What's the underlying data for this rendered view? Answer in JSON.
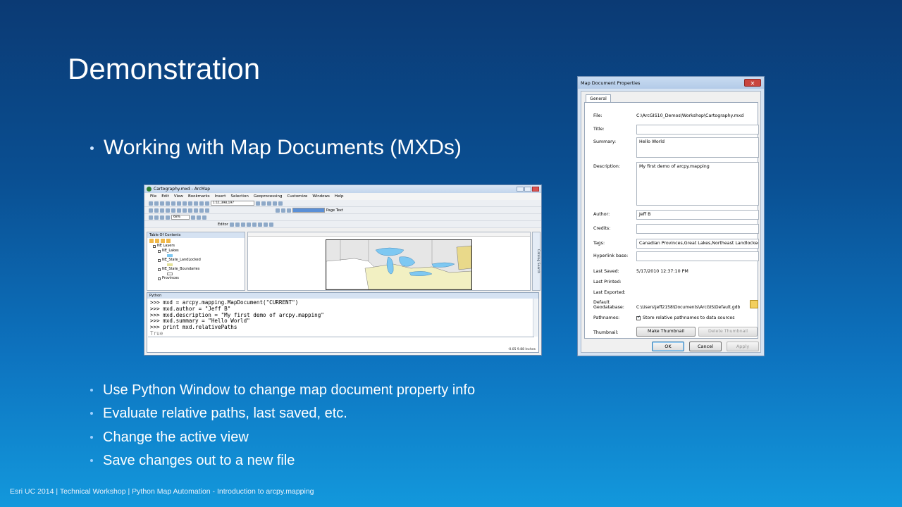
{
  "slide": {
    "title": "Demonstration",
    "main_bullet": "Working with Map Documents (MXDs)",
    "sub_bullets": [
      "Use Python Window to change map document property info",
      "Evaluate relative paths, last saved, etc.",
      "Change the active view",
      "Save changes out to a new file"
    ],
    "footer": {
      "left": "Esri UC 2014 | Technical Workshop |",
      "right": "Python Map Automation - Introduction to arcpy.mapping"
    }
  },
  "arcmap": {
    "window_title": "Cartography.mxd - ArcMap",
    "menu": [
      "File",
      "Edit",
      "View",
      "Bookmarks",
      "Insert",
      "Selection",
      "Geoprocessing",
      "Customize",
      "Windows",
      "Help"
    ],
    "scale": "1:11,398,197",
    "zoom": "68%",
    "editor_label": "Editor",
    "page_text_label": "Page Text",
    "toc_title": "Table Of Contents",
    "toc_layers": [
      {
        "name": "NE Layers",
        "level": 1
      },
      {
        "name": "NE_Lakes",
        "level": 2
      },
      {
        "name": "NE_State_LandLocked",
        "level": 2
      },
      {
        "name": "NE_State_Boundaries",
        "level": 2
      },
      {
        "name": "Provinces",
        "level": 2
      }
    ],
    "side_tabs": "Catalog  Search",
    "python_title": "Python",
    "python_lines": [
      ">>> mxd = arcpy.mapping.MapDocument(\"CURRENT\")",
      ">>> mxd.author = \"Jeff B\"",
      ">>> mxd.description = \"My first demo of arcpy.mapping\"",
      ">>> mxd.summary = \"Hello World\"",
      ">>> print mxd.relativePaths"
    ],
    "python_result": "True",
    "status": "-0.05  9.88 Inches"
  },
  "dialog": {
    "title": "Map Document Properties",
    "tab": "General",
    "file_label": "File:",
    "file_value": "C:\\ArcGIS10_Demos\\Workshop\\Cartography.mxd",
    "title_label": "Title:",
    "title_value": "",
    "summary_label": "Summary:",
    "summary_value": "Hello World",
    "description_label": "Description:",
    "description_value": "My first demo of arcpy.mapping",
    "author_label": "Author:",
    "author_value": "Jeff B",
    "credits_label": "Credits:",
    "credits_value": "",
    "tags_label": "Tags:",
    "tags_value": "Canadian Provinces,Great Lakes,Northeast Landlocked",
    "hyperlink_label": "Hyperlink base:",
    "hyperlink_value": "",
    "last_saved_label": "Last Saved:",
    "last_saved_value": "5/17/2010 12:37:10 PM",
    "last_printed_label": "Last Printed:",
    "last_exported_label": "Last Exported:",
    "default_gdb_label_1": "Default",
    "default_gdb_label_2": "Geodatabase:",
    "default_gdb_value": "C:\\Users\\jeff2158\\Documents\\ArcGIS\\Default.gdb",
    "pathnames_label": "Pathnames:",
    "pathnames_check": "Store relative pathnames to data sources",
    "thumbnail_label": "Thumbnail:",
    "make_thumbnail": "Make Thumbnail",
    "delete_thumbnail": "Delete Thumbnail",
    "ok": "OK",
    "cancel": "Cancel",
    "apply": "Apply",
    "close_glyph": "✕"
  }
}
